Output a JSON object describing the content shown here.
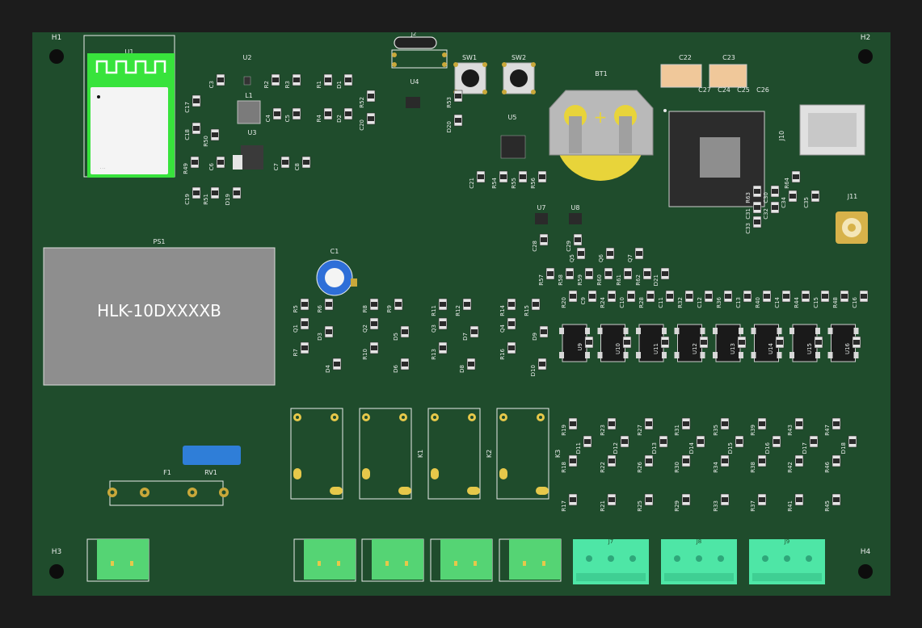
{
  "colors": {
    "board": "#1f4c2c",
    "background": "#1c1c1c",
    "silk": "#e8ecea",
    "copper": "#d8d8d8",
    "gold": "#c9a83a",
    "relay_pad": "#e6c84a",
    "terminal": "#55d474",
    "terminal3": "#4ee6a6",
    "module_grey": "#8e8e8e",
    "wifi_green": "#38e33c",
    "crystal_orange": "#f0c89a",
    "fuse_blue": "#2f7ed8"
  },
  "labels": {
    "h1": "H1",
    "h2": "H2",
    "h3": "H3",
    "h4": "H4",
    "u1": "U1",
    "u2": "U2",
    "u3": "U3",
    "u4": "U4",
    "u5": "U5",
    "u7": "U7",
    "u8": "U8",
    "l1": "L1",
    "j2": "J2",
    "j10": "J10",
    "j11": "J11",
    "sw1": "SW1",
    "sw2": "SW2",
    "bt1": "BT1",
    "c22": "C22",
    "c23": "C23",
    "c27": "C27",
    "c24": "C24",
    "c25": "C25",
    "c26": "C26",
    "ps1": "PS1",
    "ps1_text": "HLK-10DXXXXB",
    "c1": "C1",
    "f1": "F1",
    "rv1": "RV1",
    "k1": "K1",
    "k2": "K2",
    "k3": "K3",
    "j7": "J7",
    "j8": "J8",
    "j9": "J9"
  },
  "parts": {
    "small_labels": [
      "C3",
      "R2",
      "R3",
      "R1",
      "D1",
      "C17",
      "C18",
      "R50",
      "R49",
      "C6",
      "C4",
      "C5",
      "R4",
      "D2",
      "R52",
      "C20",
      "C19",
      "R51",
      "D19",
      "C7",
      "C8",
      "R53",
      "D20",
      "C21",
      "R54",
      "R55",
      "R56",
      "C28",
      "C29",
      "Q5",
      "Q6",
      "Q7",
      "R57",
      "R58",
      "R59",
      "R60",
      "R61",
      "R62",
      "D21",
      "R63",
      "C30",
      "C31",
      "C32",
      "C33",
      "C34",
      "C35",
      "R64",
      "R5",
      "R6",
      "Q1",
      "D3",
      "R7",
      "D4",
      "R8",
      "R9",
      "Q2",
      "D5",
      "R10",
      "D6",
      "R11",
      "R12",
      "Q3",
      "D7",
      "R13",
      "D8",
      "R14",
      "R15",
      "Q4",
      "D9",
      "R16",
      "D10",
      "R20",
      "C9",
      "R24",
      "C10",
      "R28",
      "C11",
      "R32",
      "C12",
      "R36",
      "C13",
      "R40",
      "C14",
      "R44",
      "C15",
      "R48",
      "C16",
      "U9",
      "U10",
      "U11",
      "U12",
      "U13",
      "U14",
      "U15",
      "U16",
      "R19",
      "R23",
      "R27",
      "R31",
      "R35",
      "R39",
      "R43",
      "R47",
      "D11",
      "D12",
      "D13",
      "D14",
      "D15",
      "D16",
      "D17",
      "D18",
      "R18",
      "R22",
      "R26",
      "R30",
      "R34",
      "R38",
      "R42",
      "R46",
      "R17",
      "R21",
      "R25",
      "R29",
      "R33",
      "R37",
      "R41",
      "R45"
    ]
  }
}
